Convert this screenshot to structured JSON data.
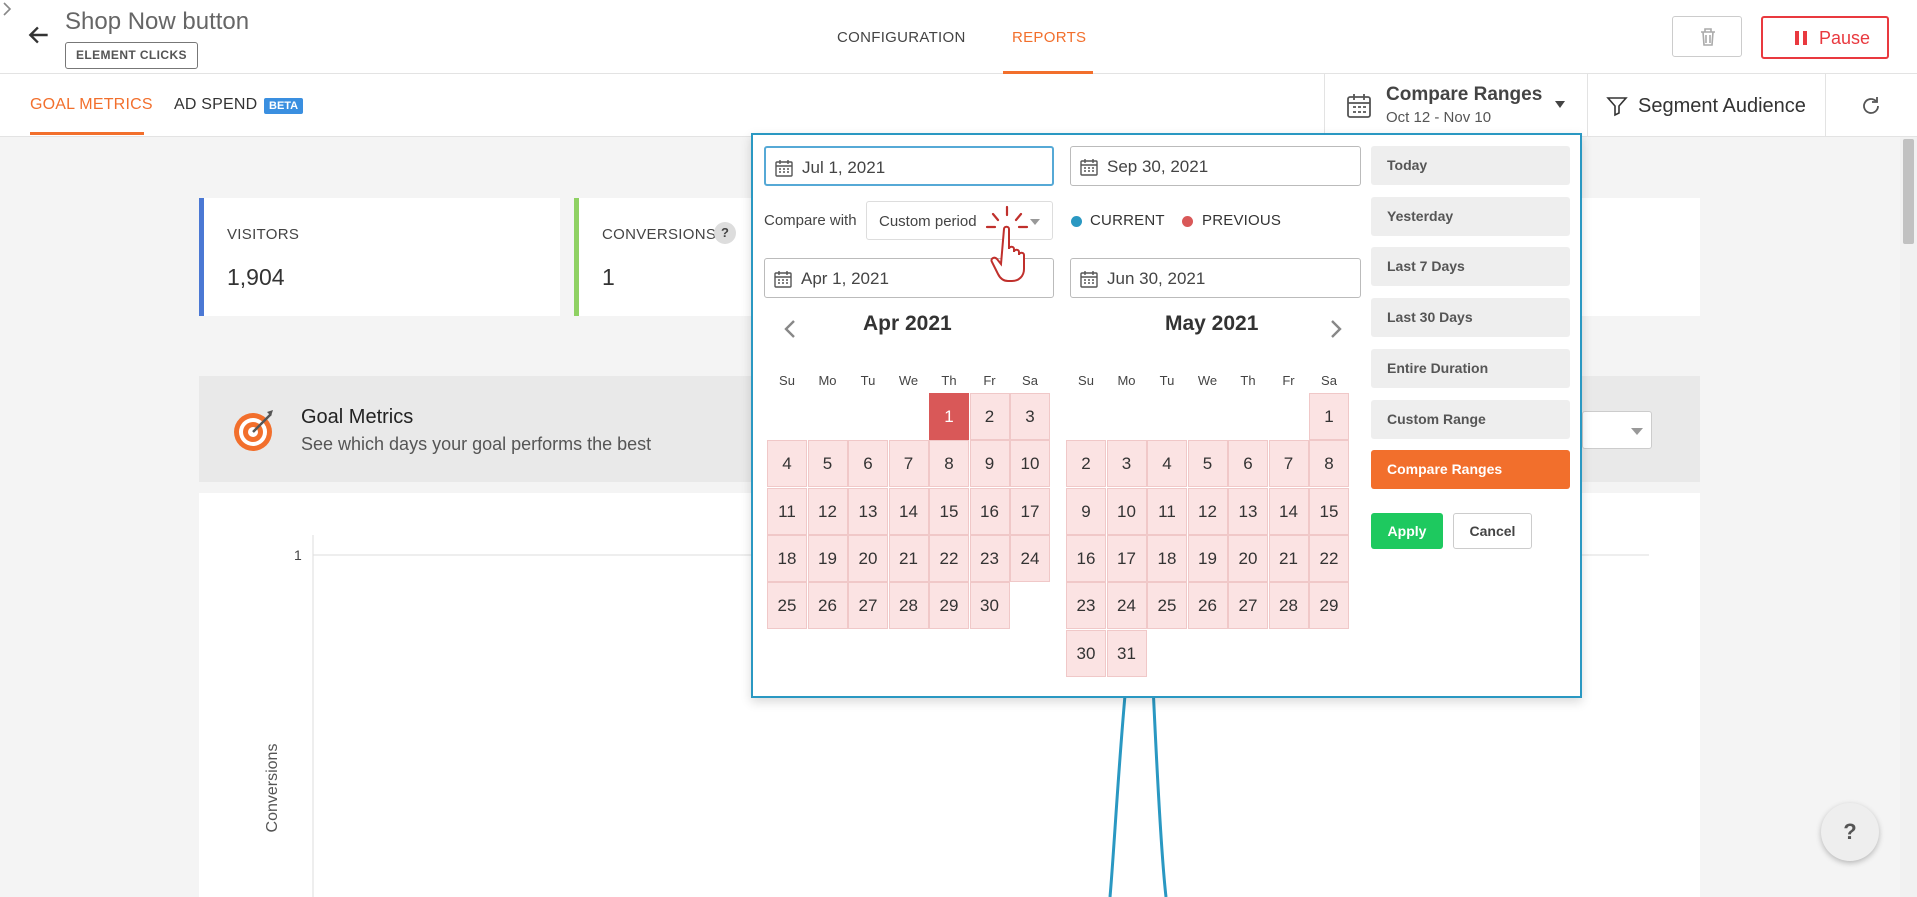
{
  "header": {
    "title": "Shop Now button",
    "badge": "ELEMENT CLICKS",
    "crumbs": {
      "config": "CONFIGURATION",
      "reports": "REPORTS"
    },
    "pause_label": "Pause",
    "accent_color": "#f26f2c",
    "danger_color": "#e9393f"
  },
  "subnav": {
    "tabs": {
      "goal": "GOAL METRICS",
      "ad": "AD SPEND"
    },
    "beta": "BETA",
    "range_title": "Compare Ranges",
    "range_sub": "Oct 12 - Nov 10",
    "segment": "Segment Audience"
  },
  "stats": {
    "visitors_label": "VISITORS",
    "visitors_value": "1,904",
    "conversions_label": "CONVERSIONS",
    "conversions_value": "1",
    "help_glyph": "?"
  },
  "goal_panel": {
    "title": "Goal Metrics",
    "subtitle": "See which days your goal performs the best"
  },
  "chart": {
    "y_tick": "1",
    "y_label": "Conversions",
    "line_color": "#2a98c2"
  },
  "picker": {
    "start_current": "Jul 1, 2021",
    "end_current": "Sep 30, 2021",
    "compare_label": "Compare with",
    "compare_value": "Custom period",
    "legend_current": "CURRENT",
    "legend_previous": "PREVIOUS",
    "start_previous": "Apr 1, 2021",
    "end_previous": "Jun 30, 2021",
    "weekdays": [
      "Su",
      "Mo",
      "Tu",
      "We",
      "Th",
      "Fr",
      "Sa"
    ],
    "months": [
      {
        "title": "Apr 2021",
        "first_weekday": 4,
        "days": 30,
        "selected": 1
      },
      {
        "title": "May 2021",
        "first_weekday": 6,
        "days": 31,
        "selected": null
      }
    ],
    "presets": [
      "Today",
      "Yesterday",
      "Last 7 Days",
      "Last 30 Days",
      "Entire Duration",
      "Custom Range",
      "Compare Ranges"
    ],
    "active_preset": "Compare Ranges",
    "apply": "Apply",
    "cancel": "Cancel"
  },
  "help_button": "?"
}
